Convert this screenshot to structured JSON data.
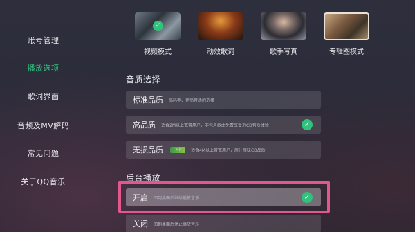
{
  "sidebar": {
    "items": [
      {
        "label": "账号管理",
        "active": false
      },
      {
        "label": "播放选项",
        "active": true
      },
      {
        "label": "歌词界面",
        "active": false
      },
      {
        "label": "音频及MV解码",
        "active": false
      },
      {
        "label": "常见问题",
        "active": false
      },
      {
        "label": "关于QQ音乐",
        "active": false
      }
    ]
  },
  "modes": [
    {
      "label": "视频模式",
      "selected": true
    },
    {
      "label": "动效歌词",
      "selected": false
    },
    {
      "label": "歌手写真",
      "selected": false
    },
    {
      "label": "专辑图模式",
      "selected": false
    }
  ],
  "quality": {
    "title": "音质选择",
    "options": [
      {
        "name": "标准品质",
        "desc": "高码率、更高音质的选择",
        "selected": false
      },
      {
        "name": "高品质",
        "desc": "适合2M以上宽带用户，非包月歌曲免费享受近CD音质体验",
        "selected": true
      },
      {
        "name": "无损品质",
        "badge": "SQ",
        "desc": "适合4M以上带宽用户，原汁原味CD品质",
        "selected": false
      }
    ]
  },
  "background_play": {
    "title": "后台播放",
    "options": [
      {
        "name": "开启",
        "desc": "回到桌面后继续播放音乐",
        "selected": true
      },
      {
        "name": "关闭",
        "desc": "回到桌面后停止播放音乐",
        "selected": false
      }
    ]
  },
  "colors": {
    "accent": "#31c27c",
    "highlight": "#e2588c"
  }
}
